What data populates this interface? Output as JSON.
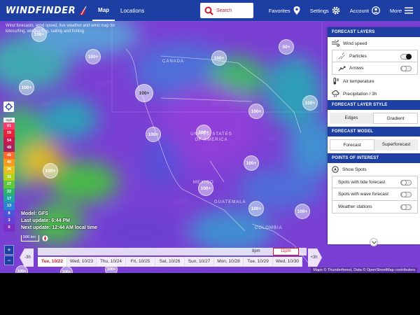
{
  "header": {
    "logo_text": "WINDFINDER",
    "nav": [
      {
        "label": "Map",
        "active": true
      },
      {
        "label": "Locations",
        "active": false
      }
    ],
    "search_placeholder": "Search",
    "favorites_label": "Favorites",
    "settings_label": "Settings",
    "account_label": "Account",
    "more_label": "More"
  },
  "map": {
    "intro": "Wind forecasts, wind speed, live weather and wind map for kitesurfing, windsurfing, sailing and fishing",
    "labels": {
      "canada": "CANADA",
      "usa": "UNITED STATES OF AMERICA",
      "mexico": "MEXICO",
      "guatemala": "GUATEMALA",
      "colombia": "COLOMBIA"
    },
    "cluster_label": "100+",
    "cluster_label_50": "50+",
    "legend_unit": "mph",
    "legend_values": [
      "61",
      "59",
      "54",
      "49",
      "45",
      "40",
      "36",
      "31",
      "27",
      "22",
      "17",
      "13",
      "8",
      "3",
      "0"
    ],
    "legend_colors": [
      "#ff3b6b",
      "#e8203c",
      "#c9184e",
      "#a6245e",
      "#ff6a2a",
      "#f59a1d",
      "#e7c11d",
      "#b0d31c",
      "#5ec83a",
      "#2cb46a",
      "#1fa2a6",
      "#2b7fd6",
      "#4a55d9",
      "#6a3fd3",
      "#7b2dc3"
    ],
    "model": "Model: GFS",
    "last_update": "Last update: 6:44 PM",
    "next_update": "Next update: 12:44 AM local time",
    "scale": "500 km",
    "attribution": "Maps © Thunderforest, Data © OpenStreetMap contributors"
  },
  "timeline": {
    "prev": "-3h",
    "next": "+3h",
    "hours": [
      {
        "label": "8pm",
        "current": false
      },
      {
        "label": "11pm",
        "current": true
      }
    ],
    "days": [
      {
        "label": "Tue, 10/22",
        "current": true
      },
      {
        "label": "Wed, 10/23",
        "current": false
      },
      {
        "label": "Thu, 10/24",
        "current": false
      },
      {
        "label": "Fri, 10/25",
        "current": false
      },
      {
        "label": "Sat, 10/26",
        "current": false
      },
      {
        "label": "Sun, 10/27",
        "current": false
      },
      {
        "label": "Mon, 10/28",
        "current": false
      },
      {
        "label": "Tue, 10/29",
        "current": false
      },
      {
        "label": "Wed, 10/30",
        "current": false
      }
    ]
  },
  "panel": {
    "forecast_layers_title": "FORECAST LAYERS",
    "wind_speed": "Wind speed",
    "particles": "Particles",
    "particles_on": true,
    "arrows": "Arrows",
    "arrows_on": false,
    "air_temperature": "Air temperature",
    "precipitation": "Precipitation / 3h",
    "style_title": "FORECAST LAYER STYLE",
    "style_options": [
      {
        "label": "Edges",
        "active": false
      },
      {
        "label": "Gradient",
        "active": true
      }
    ],
    "model_title": "FORECAST MODEL",
    "model_options": [
      {
        "label": "Forecast",
        "active": true
      },
      {
        "label": "Superforecast",
        "active": false
      }
    ],
    "poi_title": "POINTS OF INTEREST",
    "show_spots": "Show Spots",
    "tide": "Spots with tide forecast",
    "wave": "Spots with wave forecast",
    "weather_stations": "Weather stations"
  },
  "colors": {
    "brand": "#1d3fa4",
    "accent": "#d1172a"
  }
}
